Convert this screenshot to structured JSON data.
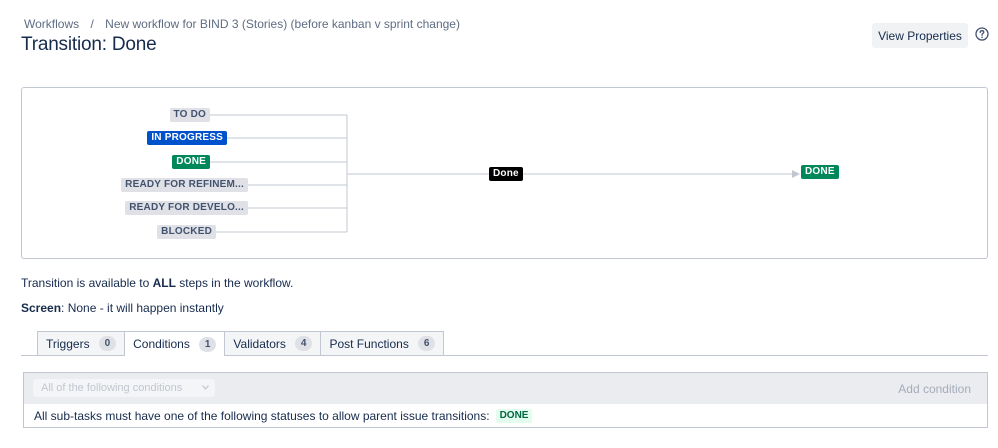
{
  "breadcrumb": {
    "root": "Workflows",
    "separator": "/",
    "workflow": "New workflow for BIND 3 (Stories) (before kanban v sprint change)"
  },
  "page_title": "Transition: Done",
  "header_actions": {
    "view_properties": "View Properties",
    "help_icon": "question-circle-icon"
  },
  "diagram": {
    "source_statuses": [
      {
        "label": "TO DO",
        "category": "gray"
      },
      {
        "label": "IN PROGRESS",
        "category": "blue"
      },
      {
        "label": "DONE",
        "category": "green"
      },
      {
        "label": "READY FOR REFINEM...",
        "category": "gray"
      },
      {
        "label": "READY FOR DEVELO...",
        "category": "gray"
      },
      {
        "label": "BLOCKED",
        "category": "gray"
      }
    ],
    "transition_label": "Done",
    "target_status": {
      "label": "DONE",
      "category": "green"
    }
  },
  "info": {
    "availability_prefix": "Transition is available to ",
    "availability_emphasis": "ALL",
    "availability_suffix": " steps in the workflow.",
    "screen_label": "Screen",
    "screen_value": ": None - it will happen instantly"
  },
  "tabs": [
    {
      "label": "Triggers",
      "count": "0",
      "active": false
    },
    {
      "label": "Conditions",
      "count": "1",
      "active": true
    },
    {
      "label": "Validators",
      "count": "4",
      "active": false
    },
    {
      "label": "Post Functions",
      "count": "6",
      "active": false
    }
  ],
  "conditions": {
    "group_select": "All of the following conditions",
    "add_condition": "Add condition",
    "rule_text": "All sub-tasks must have one of the following statuses to allow parent issue transitions:",
    "rule_status": "DONE"
  },
  "colors": {
    "gray_lozenge": "#dfe1e6",
    "blue_lozenge": "#0052cc",
    "green_lozenge": "#00875a",
    "text": "#172b4d"
  }
}
